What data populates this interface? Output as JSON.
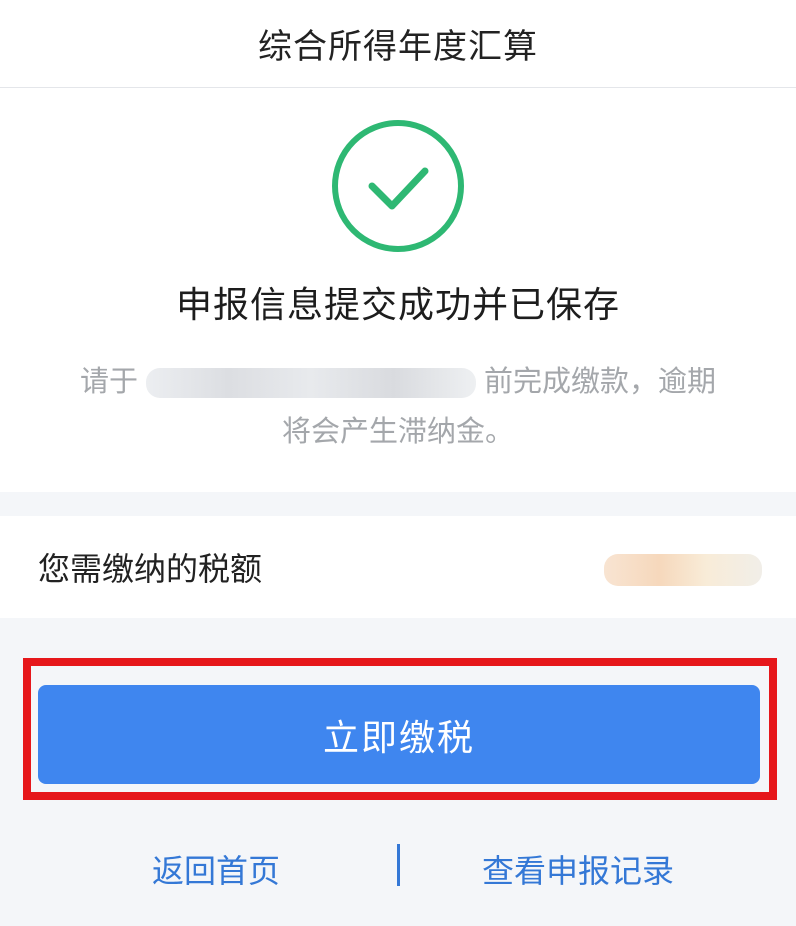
{
  "header": {
    "title": "综合所得年度汇算"
  },
  "result": {
    "icon": "check-circle-icon",
    "title": "申报信息提交成功并已保存",
    "notice_prefix": "请于",
    "notice_suffix": "前完成缴款，逾期将会产生滞纳金。"
  },
  "tax": {
    "label": "您需缴纳的税额"
  },
  "actions": {
    "pay_label": "立即缴税",
    "home_label": "返回首页",
    "records_label": "查看申报记录"
  },
  "colors": {
    "success_green": "#2eb873",
    "primary_blue": "#3f86ef",
    "link_blue": "#3478d6",
    "highlight_red": "#e6171b"
  }
}
